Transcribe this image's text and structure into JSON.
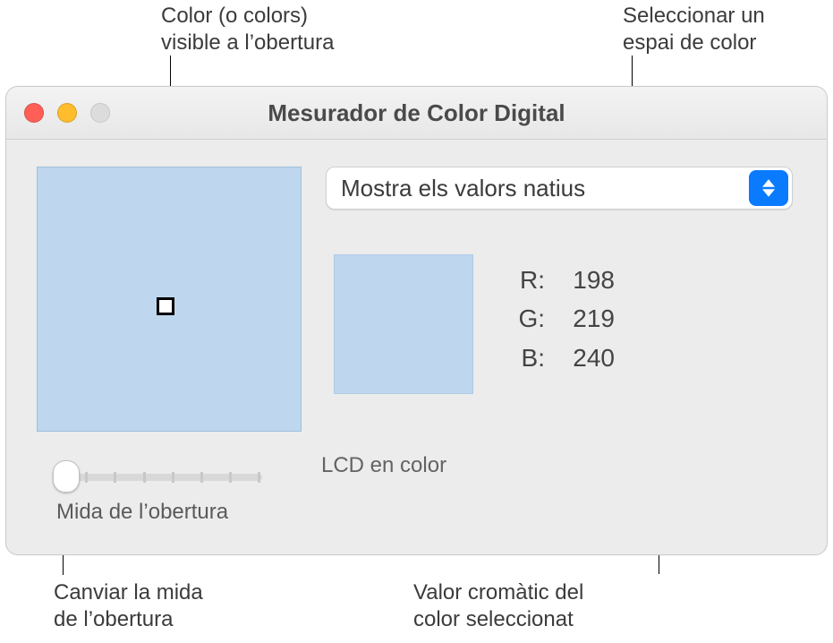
{
  "callouts": {
    "aperture_preview": "Color (o colors)\nvisible a l’obertura",
    "color_space": "Seleccionar un\nespai de color",
    "aperture_size": "Canviar la mida\nde l’obertura",
    "rgb_readout": "Valor cromàtic del\ncolor seleccionat"
  },
  "window": {
    "title": "Mesurador de Color Digital"
  },
  "color_space_popup": {
    "selected": "Mostra els valors natius"
  },
  "sampled_color_hex": "#bfd7ee",
  "rgb": {
    "r_label": "R:",
    "g_label": "G:",
    "b_label": "B:",
    "r": "198",
    "g": "219",
    "b": "240"
  },
  "display_name": "LCD en color",
  "aperture_slider": {
    "label": "Mida de l’obertura"
  }
}
